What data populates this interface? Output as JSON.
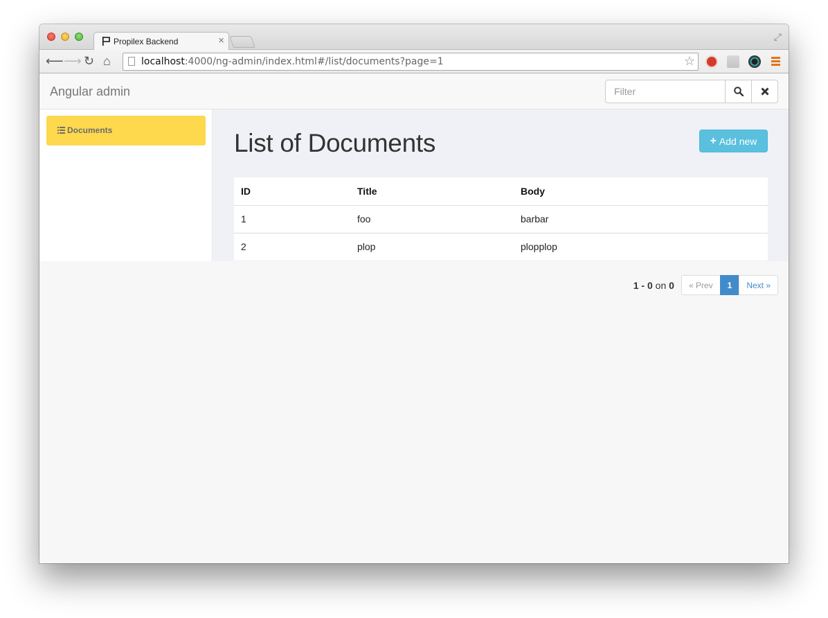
{
  "browser": {
    "tab_title": "Propilex Backend",
    "tab_close": "×",
    "url_host": "localhost",
    "url_rest": ":4000/ng-admin/index.html#/list/documents?page=1"
  },
  "app": {
    "brand": "Angular admin",
    "filter_placeholder": "Filter",
    "filter_value": ""
  },
  "sidebar": {
    "items": [
      {
        "label": "Documents",
        "icon": "list-icon",
        "active": true
      }
    ]
  },
  "main": {
    "title": "List of Documents",
    "add_label": "Add new",
    "add_icon": "plus-icon"
  },
  "table": {
    "columns": [
      "ID",
      "Title",
      "Body"
    ],
    "rows": [
      [
        "1",
        "foo",
        "barbar"
      ],
      [
        "2",
        "plop",
        "plopplop"
      ]
    ]
  },
  "pagination": {
    "range_start": "1",
    "range_end": "0",
    "of_word": "on",
    "total": "0",
    "prev_label": "« Prev",
    "current_page": "1",
    "next_label": "Next »"
  },
  "colors": {
    "sidebar_active": "#fed84d",
    "add_button": "#5bc0de",
    "pagination_active": "#428bca"
  }
}
